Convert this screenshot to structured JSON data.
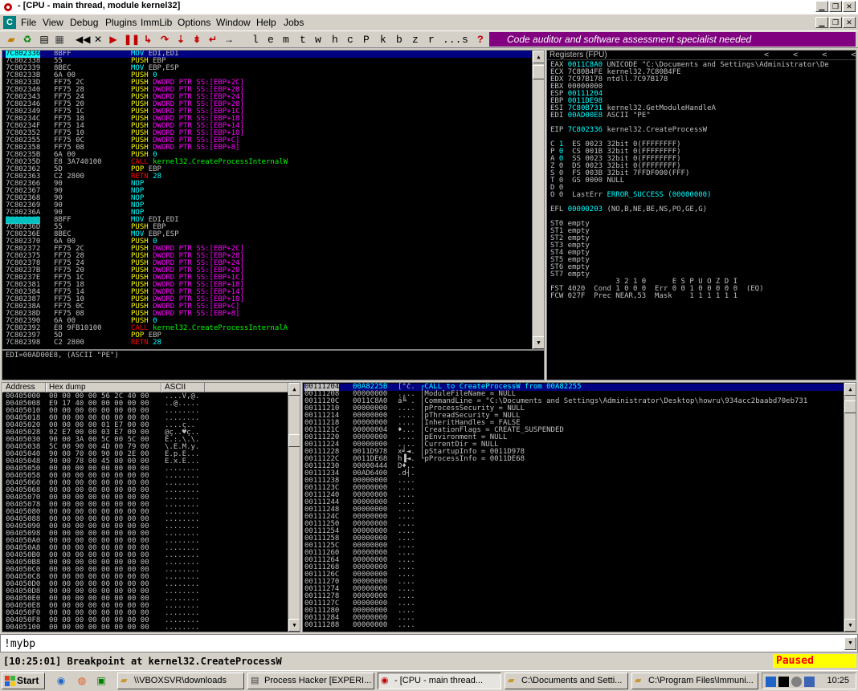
{
  "window": {
    "title": "- [CPU - main thread, module kernel32]"
  },
  "menu": [
    "File",
    "View",
    "Debug",
    "Plugins",
    "ImmLib",
    "Options",
    "Window",
    "Help",
    "Jobs"
  ],
  "toolbar": {
    "letters": [
      "l",
      "e",
      "m",
      "t",
      "w",
      "h",
      "c",
      "P",
      "k",
      "b",
      "z",
      "r",
      "...",
      "s",
      "?"
    ],
    "banner": "Code auditor and software assessment specialist needed"
  },
  "disasm": {
    "rows": [
      {
        "addr": "7C802336",
        "hex": "8BFF",
        "op": "MOV",
        "ops": [
          [
            "EDI,EDI",
            "reg"
          ]
        ],
        "k": "mov"
      },
      {
        "addr": "7C802338",
        "hex": "55",
        "op": "PUSH",
        "ops": [
          [
            "EBP",
            "reg"
          ]
        ],
        "k": "push"
      },
      {
        "addr": "7C802339",
        "hex": "8BEC",
        "op": "MOV",
        "ops": [
          [
            "EBP,ESP",
            "reg"
          ]
        ],
        "k": "mov"
      },
      {
        "addr": "7C80233B",
        "hex": "6A 00",
        "op": "PUSH",
        "ops": [
          [
            "0",
            "imm"
          ]
        ],
        "k": "push"
      },
      {
        "addr": "7C80233D",
        "hex": "FF75 2C",
        "op": "PUSH",
        "ops": [
          [
            "DWORD PTR SS:[EBP+2C]",
            "mem"
          ]
        ],
        "k": "push"
      },
      {
        "addr": "7C802340",
        "hex": "FF75 28",
        "op": "PUSH",
        "ops": [
          [
            "DWORD PTR SS:[EBP+28]",
            "mem"
          ]
        ],
        "k": "push"
      },
      {
        "addr": "7C802343",
        "hex": "FF75 24",
        "op": "PUSH",
        "ops": [
          [
            "DWORD PTR SS:[EBP+24]",
            "mem"
          ]
        ],
        "k": "push"
      },
      {
        "addr": "7C802346",
        "hex": "FF75 20",
        "op": "PUSH",
        "ops": [
          [
            "DWORD PTR SS:[EBP+20]",
            "mem"
          ]
        ],
        "k": "push"
      },
      {
        "addr": "7C802349",
        "hex": "FF75 1C",
        "op": "PUSH",
        "ops": [
          [
            "DWORD PTR SS:[EBP+1C]",
            "mem"
          ]
        ],
        "k": "push"
      },
      {
        "addr": "7C80234C",
        "hex": "FF75 18",
        "op": "PUSH",
        "ops": [
          [
            "DWORD PTR SS:[EBP+18]",
            "mem"
          ]
        ],
        "k": "push"
      },
      {
        "addr": "7C80234F",
        "hex": "FF75 14",
        "op": "PUSH",
        "ops": [
          [
            "DWORD PTR SS:[EBP+14]",
            "mem"
          ]
        ],
        "k": "push"
      },
      {
        "addr": "7C802352",
        "hex": "FF75 10",
        "op": "PUSH",
        "ops": [
          [
            "DWORD PTR SS:[EBP+10]",
            "mem"
          ]
        ],
        "k": "push"
      },
      {
        "addr": "7C802355",
        "hex": "FF75 0C",
        "op": "PUSH",
        "ops": [
          [
            "DWORD PTR SS:[EBP+C]",
            "mem"
          ]
        ],
        "k": "push"
      },
      {
        "addr": "7C802358",
        "hex": "FF75 08",
        "op": "PUSH",
        "ops": [
          [
            "DWORD PTR SS:[EBP+8]",
            "mem"
          ]
        ],
        "k": "push"
      },
      {
        "addr": "7C80235B",
        "hex": "6A 00",
        "op": "PUSH",
        "ops": [
          [
            "0",
            "imm"
          ]
        ],
        "k": "push"
      },
      {
        "addr": "7C80235D",
        "hex": "E8 3A740100",
        "op": "CALL",
        "ops": [
          [
            "kernel32.CreateProcessInternalW",
            "fn"
          ]
        ],
        "k": "call"
      },
      {
        "addr": "7C802362",
        "hex": "5D",
        "op": "POP",
        "ops": [
          [
            "EBP",
            "reg"
          ]
        ],
        "k": "pop"
      },
      {
        "addr": "7C802363",
        "hex": "C2 2800",
        "op": "RETN",
        "ops": [
          [
            "28",
            "imm"
          ]
        ],
        "k": "retn"
      },
      {
        "addr": "7C802366",
        "hex": "90",
        "op": "NOP",
        "ops": [],
        "k": "nop"
      },
      {
        "addr": "7C802367",
        "hex": "90",
        "op": "NOP",
        "ops": [],
        "k": "nop"
      },
      {
        "addr": "7C802368",
        "hex": "90",
        "op": "NOP",
        "ops": [],
        "k": "nop"
      },
      {
        "addr": "7C802369",
        "hex": "90",
        "op": "NOP",
        "ops": [],
        "k": "nop"
      },
      {
        "addr": "7C80236A",
        "hex": "90",
        "op": "NOP",
        "ops": [],
        "k": "nop"
      },
      {
        "addr": "7C80236B",
        "hex": "8BFF",
        "op": "MOV",
        "ops": [
          [
            "EDI,EDI",
            "reg"
          ]
        ],
        "k": "mov",
        "mark": true
      },
      {
        "addr": "7C80236D",
        "hex": "55",
        "op": "PUSH",
        "ops": [
          [
            "EBP",
            "reg"
          ]
        ],
        "k": "push"
      },
      {
        "addr": "7C80236E",
        "hex": "8BEC",
        "op": "MOV",
        "ops": [
          [
            "EBP,ESP",
            "reg"
          ]
        ],
        "k": "mov"
      },
      {
        "addr": "7C802370",
        "hex": "6A 00",
        "op": "PUSH",
        "ops": [
          [
            "0",
            "imm"
          ]
        ],
        "k": "push"
      },
      {
        "addr": "7C802372",
        "hex": "FF75 2C",
        "op": "PUSH",
        "ops": [
          [
            "DWORD PTR SS:[EBP+2C]",
            "mem"
          ]
        ],
        "k": "push"
      },
      {
        "addr": "7C802375",
        "hex": "FF75 28",
        "op": "PUSH",
        "ops": [
          [
            "DWORD PTR SS:[EBP+28]",
            "mem"
          ]
        ],
        "k": "push"
      },
      {
        "addr": "7C802378",
        "hex": "FF75 24",
        "op": "PUSH",
        "ops": [
          [
            "DWORD PTR SS:[EBP+24]",
            "mem"
          ]
        ],
        "k": "push"
      },
      {
        "addr": "7C80237B",
        "hex": "FF75 20",
        "op": "PUSH",
        "ops": [
          [
            "DWORD PTR SS:[EBP+20]",
            "mem"
          ]
        ],
        "k": "push"
      },
      {
        "addr": "7C80237E",
        "hex": "FF75 1C",
        "op": "PUSH",
        "ops": [
          [
            "DWORD PTR SS:[EBP+1C]",
            "mem"
          ]
        ],
        "k": "push"
      },
      {
        "addr": "7C802381",
        "hex": "FF75 18",
        "op": "PUSH",
        "ops": [
          [
            "DWORD PTR SS:[EBP+18]",
            "mem"
          ]
        ],
        "k": "push"
      },
      {
        "addr": "7C802384",
        "hex": "FF75 14",
        "op": "PUSH",
        "ops": [
          [
            "DWORD PTR SS:[EBP+14]",
            "mem"
          ]
        ],
        "k": "push"
      },
      {
        "addr": "7C802387",
        "hex": "FF75 10",
        "op": "PUSH",
        "ops": [
          [
            "DWORD PTR SS:[EBP+10]",
            "mem"
          ]
        ],
        "k": "push"
      },
      {
        "addr": "7C80238A",
        "hex": "FF75 0C",
        "op": "PUSH",
        "ops": [
          [
            "DWORD PTR SS:[EBP+C]",
            "mem"
          ]
        ],
        "k": "push"
      },
      {
        "addr": "7C80238D",
        "hex": "FF75 08",
        "op": "PUSH",
        "ops": [
          [
            "DWORD PTR SS:[EBP+8]",
            "mem"
          ]
        ],
        "k": "push"
      },
      {
        "addr": "7C802390",
        "hex": "6A 00",
        "op": "PUSH",
        "ops": [
          [
            "0",
            "imm"
          ]
        ],
        "k": "push"
      },
      {
        "addr": "7C802392",
        "hex": "E8 9FB10100",
        "op": "CALL",
        "ops": [
          [
            "kernel32.CreateProcessInternalA",
            "fn"
          ]
        ],
        "k": "call"
      },
      {
        "addr": "7C802397",
        "hex": "5D",
        "op": "POP",
        "ops": [
          [
            "EBP",
            "reg"
          ]
        ],
        "k": "pop"
      },
      {
        "addr": "7C802398",
        "hex": "C2 2800",
        "op": "RETN",
        "ops": [
          [
            "28",
            "imm"
          ]
        ],
        "k": "retn"
      }
    ],
    "info": "EDI=00AD00E8, (ASCII \"PE\")"
  },
  "registers": {
    "header": "Registers (FPU)",
    "rows": [
      [
        [
          "EAX ",
          ""
        ],
        [
          "0011C8A0",
          "v"
        ],
        [
          " UNICODE \"C:\\Documents and Settings\\Administrator\\De",
          ""
        ]
      ],
      [
        [
          "ECX 7C80B4FE kernel32.7C80B4FE",
          ""
        ]
      ],
      [
        [
          "EDX 7C97B178 ntdll.7C97B178",
          ""
        ]
      ],
      [
        [
          "EBX 00000000",
          ""
        ]
      ],
      [
        [
          "ESP ",
          ""
        ],
        [
          "00111204",
          "v"
        ]
      ],
      [
        [
          "EBP ",
          ""
        ],
        [
          "0011DE98",
          "v"
        ]
      ],
      [
        [
          "ESI ",
          ""
        ],
        [
          "7C80B731",
          "v"
        ],
        [
          " kernel32.GetModuleHandleA",
          ""
        ]
      ],
      [
        [
          "EDI ",
          ""
        ],
        [
          "00AD00E8",
          "v"
        ],
        [
          " ASCII \"PE\"",
          ""
        ]
      ],
      [
        [
          "",
          ""
        ]
      ],
      [
        [
          "EIP ",
          ""
        ],
        [
          "7C802336",
          "v"
        ],
        [
          " kernel32.CreateProcessW",
          ""
        ]
      ],
      [
        [
          "",
          ""
        ]
      ],
      [
        [
          "C ",
          ""
        ],
        [
          "1",
          "v"
        ],
        [
          "  ES 0023 32bit 0(FFFFFFFF)",
          ""
        ]
      ],
      [
        [
          "P ",
          ""
        ],
        [
          "0",
          "v"
        ],
        [
          "  CS 001B 32bit 0(FFFFFFFF)",
          ""
        ]
      ],
      [
        [
          "A ",
          ""
        ],
        [
          "0",
          "v"
        ],
        [
          "  SS 0023 32bit 0(FFFFFFFF)",
          ""
        ]
      ],
      [
        [
          "Z 0  DS 0023 32bit 0(FFFFFFFF)",
          ""
        ]
      ],
      [
        [
          "S 0  FS 003B 32bit 7FFDF000(FFF)",
          ""
        ]
      ],
      [
        [
          "T 0  GS 0000 NULL",
          ""
        ]
      ],
      [
        [
          "D 0",
          ""
        ]
      ],
      [
        [
          "O 0  LastErr ",
          ""
        ],
        [
          "ERROR_SUCCESS (00000000)",
          "v"
        ]
      ],
      [
        [
          "",
          ""
        ]
      ],
      [
        [
          "EFL ",
          ""
        ],
        [
          "00000203",
          "v"
        ],
        [
          " (NO,B,NE,BE,NS,PO,GE,G)",
          ""
        ]
      ],
      [
        [
          "",
          ""
        ]
      ],
      [
        [
          "ST0 empty",
          ""
        ]
      ],
      [
        [
          "ST1 empty",
          ""
        ]
      ],
      [
        [
          "ST2 empty",
          ""
        ]
      ],
      [
        [
          "ST3 empty",
          ""
        ]
      ],
      [
        [
          "ST4 empty",
          ""
        ]
      ],
      [
        [
          "ST5 empty",
          ""
        ]
      ],
      [
        [
          "ST6 empty",
          ""
        ]
      ],
      [
        [
          "ST7 empty",
          ""
        ]
      ],
      [
        [
          "               3 2 1 0      E S P U O Z D I",
          ""
        ]
      ],
      [
        [
          "FST 4020  Cond 1 0 0 0  Err 0 0 1 0 0 0 0 0  (EQ)",
          ""
        ]
      ],
      [
        [
          "FCW 027F  Prec NEAR,53  Mask    1 1 1 1 1 1",
          ""
        ]
      ]
    ]
  },
  "dump": {
    "headers": [
      "Address",
      "Hex dump",
      "ASCII"
    ],
    "rows": [
      [
        "00405000",
        "00 00 00 00 56 2C 40 00",
        "....V,@."
      ],
      [
        "00405008",
        "E9 17 40 00 00 00 00 00",
        "..@....."
      ],
      [
        "00405010",
        "00 00 00 00 00 00 00 00",
        "........"
      ],
      [
        "00405018",
        "00 00 00 00 00 00 00 00",
        "........"
      ],
      [
        "00405020",
        "00 00 00 00 01 E7 00 00",
        "....ç.."
      ],
      [
        "00405028",
        "02 E7 00 00 03 E7 00 00",
        "@ç..♥ç.."
      ],
      [
        "00405030",
        "90 00 3A 00 5C 00 5C 00",
        "E.:.\\.\\."
      ],
      [
        "00405038",
        "5C 00 90 00 4D 00 79 00",
        "\\.E.M.y."
      ],
      [
        "00405040",
        "90 00 70 00 90 00 2E 00",
        "E.p.E..."
      ],
      [
        "00405048",
        "90 00 78 00 45 00 00 00",
        "E.x.E..."
      ],
      [
        "00405050",
        "00 00 00 00 00 00 00 00",
        "........"
      ],
      [
        "00405058",
        "00 00 00 00 00 00 00 00",
        "........"
      ],
      [
        "00405060",
        "00 00 00 00 00 00 00 00",
        "........"
      ],
      [
        "00405068",
        "00 00 00 00 00 00 00 00",
        "........"
      ],
      [
        "00405070",
        "00 00 00 00 00 00 00 00",
        "........"
      ],
      [
        "00405078",
        "00 00 00 00 00 00 00 00",
        "........"
      ],
      [
        "00405080",
        "00 00 00 00 00 00 00 00",
        "........"
      ],
      [
        "00405088",
        "00 00 00 00 00 00 00 00",
        "........"
      ],
      [
        "00405090",
        "00 00 00 00 00 00 00 00",
        "........"
      ],
      [
        "00405098",
        "00 00 00 00 00 00 00 00",
        "........"
      ],
      [
        "004050A0",
        "00 00 00 00 00 00 00 00",
        "........"
      ],
      [
        "004050A8",
        "00 00 00 00 00 00 00 00",
        "........"
      ],
      [
        "004050B0",
        "00 00 00 00 00 00 00 00",
        "........"
      ],
      [
        "004050B8",
        "00 00 00 00 00 00 00 00",
        "........"
      ],
      [
        "004050C0",
        "00 00 00 00 00 00 00 00",
        "........"
      ],
      [
        "004050C8",
        "00 00 00 00 00 00 00 00",
        "........"
      ],
      [
        "004050D0",
        "00 00 00 00 00 00 00 00",
        "........"
      ],
      [
        "004050D8",
        "00 00 00 00 00 00 00 00",
        "........"
      ],
      [
        "004050E0",
        "00 00 00 00 00 00 00 00",
        "........"
      ],
      [
        "004050E8",
        "00 00 00 00 00 00 00 00",
        "........"
      ],
      [
        "004050F0",
        "00 00 00 00 00 00 00 00",
        "........"
      ],
      [
        "004050F8",
        "00 00 00 00 00 00 00 00",
        "........"
      ],
      [
        "00405100",
        "00 00 00 00 00 00 00 00",
        "........"
      ]
    ]
  },
  "stack": {
    "rows": [
      [
        "00111204",
        "00A8225B",
        "[\"č.",
        "┌CALL to CreateProcessW from 00A82255"
      ],
      [
        "00111208",
        "00000000",
        "....",
        "│ModuleFileName = NULL"
      ],
      [
        "0011120C",
        "0011C8A0",
        "á╚ .",
        "│CommandLine = \"C:\\Documents and Settings\\Administrator\\Desktop\\howru\\934acc2baabd70eb731"
      ],
      [
        "00111210",
        "00000000",
        "....",
        "│pProcessSecurity = NULL"
      ],
      [
        "00111214",
        "00000000",
        "....",
        "│pThreadSecurity = NULL"
      ],
      [
        "00111218",
        "00000000",
        "....",
        "│InheritHandles = FALSE"
      ],
      [
        "0011121C",
        "00000004",
        "♦...",
        "│CreationFlags = CREATE_SUSPENDED"
      ],
      [
        "00111220",
        "00000000",
        "....",
        "│pEnvironment = NULL"
      ],
      [
        "00111224",
        "00000000",
        "....",
        "│CurrentDir = NULL"
      ],
      [
        "00111228",
        "0011D978",
        "x╛◄.",
        "│pStartupInfo = 0011D978"
      ],
      [
        "0011122C",
        "0011DE68",
        "h▐◄.",
        "└pProcessInfo = 0011DE68"
      ],
      [
        "00111230",
        "00000444",
        "D♦..",
        ""
      ],
      [
        "00111234",
        "00AD6400",
        ".d┤.",
        ""
      ],
      [
        "00111238",
        "00000000",
        "....",
        ""
      ],
      [
        "0011123C",
        "00000000",
        "....",
        ""
      ],
      [
        "00111240",
        "00000000",
        "....",
        ""
      ],
      [
        "00111244",
        "00000000",
        "....",
        ""
      ],
      [
        "00111248",
        "00000000",
        "....",
        ""
      ],
      [
        "0011124C",
        "00000000",
        "....",
        ""
      ],
      [
        "00111250",
        "00000000",
        "....",
        ""
      ],
      [
        "00111254",
        "00000000",
        "....",
        ""
      ],
      [
        "00111258",
        "00000000",
        "....",
        ""
      ],
      [
        "0011125C",
        "00000000",
        "....",
        ""
      ],
      [
        "00111260",
        "00000000",
        "....",
        ""
      ],
      [
        "00111264",
        "00000000",
        "....",
        ""
      ],
      [
        "00111268",
        "00000000",
        "....",
        ""
      ],
      [
        "0011126C",
        "00000000",
        "....",
        ""
      ],
      [
        "00111270",
        "00000000",
        "....",
        ""
      ],
      [
        "00111274",
        "00000000",
        "....",
        ""
      ],
      [
        "00111278",
        "00000000",
        "....",
        ""
      ],
      [
        "0011127C",
        "00000000",
        "....",
        ""
      ],
      [
        "00111280",
        "00000000",
        "....",
        ""
      ],
      [
        "00111284",
        "00000000",
        "....",
        ""
      ],
      [
        "00111288",
        "00000000",
        "....",
        ""
      ]
    ]
  },
  "command": {
    "value": "!mybp"
  },
  "status": {
    "message": "[10:25:01] Breakpoint at kernel32.CreateProcessW",
    "state": "Paused"
  },
  "taskbar": {
    "start": "Start",
    "tasks": [
      "\\\\VBOXSVR\\downloads",
      "Process Hacker [EXPERI...",
      "- [CPU - main thread...",
      "C:\\Documents and Setti...",
      "C:\\Program Files\\Immuni..."
    ],
    "clock": "10:25"
  },
  "colors": {
    "banner": "#800080",
    "paused_bg": "#ffff00",
    "paused_fg": "#ff0000",
    "selection": "#000080",
    "cyan": "#00ffff",
    "magenta": "#ff00ff"
  }
}
